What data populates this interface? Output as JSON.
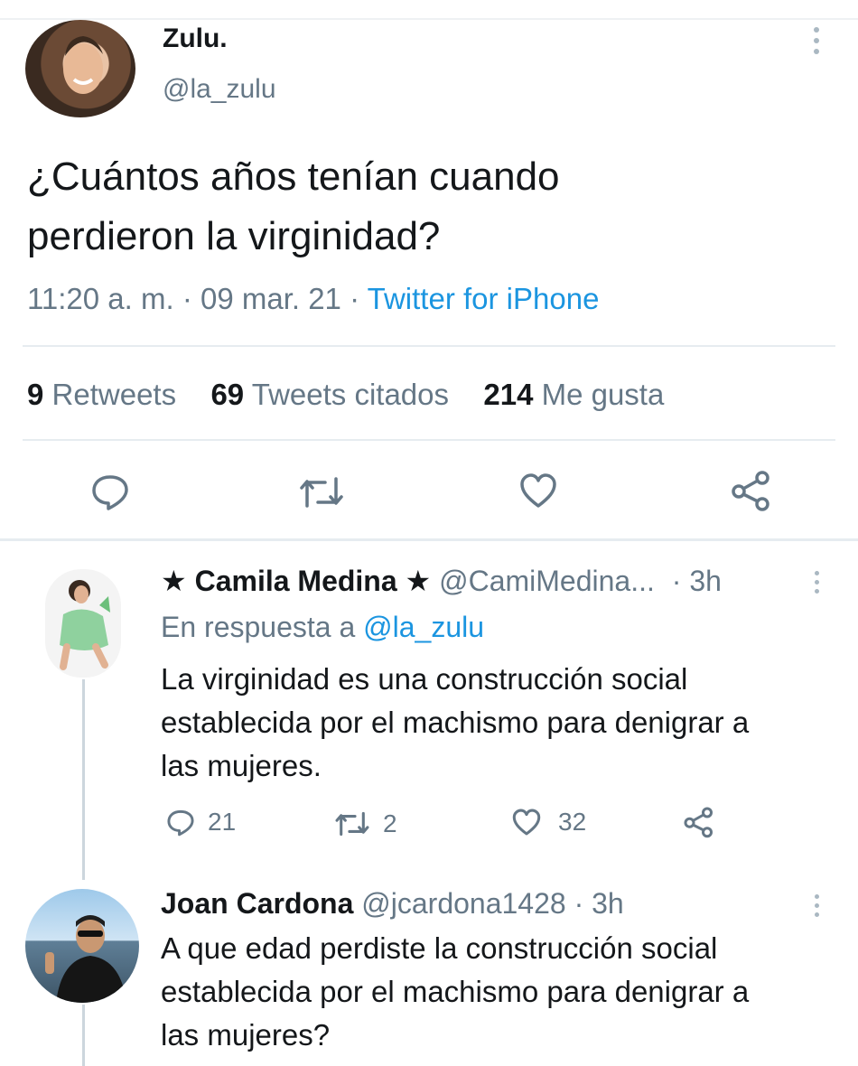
{
  "main_tweet": {
    "author_name": "Zulu.",
    "author_handle": "@la_zulu",
    "text_line1": "¿Cuántos años tenían cuando",
    "text_line2": "perdieron la virginidad?",
    "meta_time": "11:20 a. m. · 09 mar. 21 ·",
    "meta_source": "Twitter for iPhone",
    "stats": {
      "retweets_count": "9",
      "retweets_label": "Retweets",
      "quotes_count": "69",
      "quotes_label": "Tweets citados",
      "likes_count": "214",
      "likes_label": "Me gusta"
    },
    "actions": [
      "reply-icon",
      "retweet-icon",
      "like-icon",
      "share-icon"
    ]
  },
  "replies": [
    {
      "author_name": "★ Camila Medina ★",
      "author_handle": "@CamiMedina...",
      "time": "· 3h",
      "reply_prefix": "En respuesta a",
      "reply_to": "@la_zulu",
      "text_line1": "La virginidad es una construcción social",
      "text_line2": "establecida por el machismo para denigrar a",
      "text_line3": "las mujeres.",
      "reply_count": "21",
      "retweet_count": "2",
      "like_count": "32"
    },
    {
      "author_name": "Joan Cardona",
      "author_handle": "@jcardona1428",
      "time": "· 3h",
      "text_line1": "A que edad perdiste la construcción social",
      "text_line2": "establecida por el machismo para denigrar a",
      "text_line3": "las mujeres?"
    }
  ],
  "colors": {
    "link": "#1b95e0",
    "muted": "#657786",
    "text": "#14171a",
    "divider": "#e6ecf0"
  }
}
